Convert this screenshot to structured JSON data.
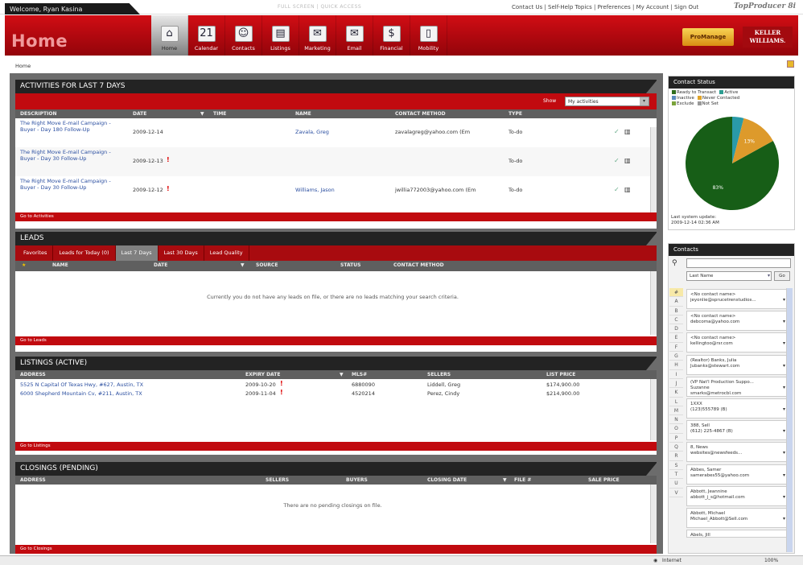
{
  "topbar": {
    "welcome": "Welcome, Ryan Kasina",
    "quick_links": "FULL SCREEN  |  QUICK ACCESS",
    "links": "Contact Us | Self-Help Topics | Preferences | My Account | Sign Out",
    "brand": "TopProducer 8i"
  },
  "header": {
    "title": "Home",
    "promanage": "ProManage",
    "kw_logo": "KELLER WILLIAMS.",
    "nav": [
      {
        "label": "Home",
        "icon": "home-icon",
        "glyph": "⌂"
      },
      {
        "label": "Calendar",
        "icon": "calendar-icon",
        "glyph": "21"
      },
      {
        "label": "Contacts",
        "icon": "contacts-icon",
        "glyph": "☺"
      },
      {
        "label": "Listings",
        "icon": "listings-icon",
        "glyph": "▤"
      },
      {
        "label": "Marketing",
        "icon": "marketing-icon",
        "glyph": "✉"
      },
      {
        "label": "Email",
        "icon": "email-icon",
        "glyph": "✉"
      },
      {
        "label": "Financial",
        "icon": "financial-icon",
        "glyph": "$"
      },
      {
        "label": "Mobility",
        "icon": "mobility-icon",
        "glyph": "▯"
      }
    ]
  },
  "breadcrumb": "Home",
  "activities": {
    "title": "ACTIVITIES FOR LAST 7 DAYS",
    "show_label": "Show",
    "show_value": "My activities",
    "headers": [
      "DESCRIPTION",
      "DATE",
      "TIME",
      "NAME",
      "CONTACT METHOD",
      "TYPE"
    ],
    "rows": [
      {
        "desc": "The Right Move E-mail Campaign - Buyer - Day 180 Follow-Up",
        "date": "2009-12-14",
        "name": "Zavala, Greg",
        "method": "zavalagreg@yahoo.com (Em",
        "type": "To-do"
      },
      {
        "desc": "The Right Move E-mail Campaign - Buyer - Day 30 Follow-Up",
        "date": "2009-12-13",
        "name": "",
        "method": "",
        "type": "To-do"
      },
      {
        "desc": "The Right Move E-mail Campaign - Buyer - Day 30 Follow-Up",
        "date": "2009-12-12",
        "name": "Williams, Jason",
        "method": "jwillia772003@yahoo.com (Em",
        "type": "To-do"
      }
    ],
    "footer": "Go to Activities"
  },
  "leads": {
    "title": "LEADS",
    "tabs": [
      "Favorites",
      "Leads for Today (0)",
      "Last 7 Days",
      "Last 30 Days",
      "Lead Quality"
    ],
    "headers": [
      "NAME",
      "DATE",
      "SOURCE",
      "STATUS",
      "CONTACT METHOD"
    ],
    "empty": "Currently you do not have any leads on file, or there are no leads matching your search criteria.",
    "footer": "Go to Leads"
  },
  "listings": {
    "title": "LISTINGS (ACTIVE)",
    "headers": [
      "ADDRESS",
      "EXPIRY DATE",
      "MLS#",
      "SELLERS",
      "LIST PRICE"
    ],
    "rows": [
      {
        "address": "5525 N Capital Of Texas Hwy, #627, Austin, TX",
        "expiry": "2009-10-20",
        "mls": "6880090",
        "sellers": "Liddell, Greg",
        "price": "$174,900.00"
      },
      {
        "address": "6000 Shepherd Mountain Cv, #211, Austin, TX",
        "expiry": "2009-11-04",
        "mls": "4520214",
        "sellers": "Perez, Cindy",
        "price": "$214,900.00"
      }
    ],
    "footer": "Go to Listings"
  },
  "closings": {
    "title": "CLOSINGS (PENDING)",
    "headers": [
      "ADDRESS",
      "SELLERS",
      "BUYERS",
      "CLOSING DATE",
      "FILE #",
      "SALE PRICE"
    ],
    "empty": "There are no pending closings on file.",
    "footer": "Go to Closings"
  },
  "contact_status": {
    "title": "Contact Status",
    "legend": [
      {
        "label": "Ready to Transact",
        "color": "#2f6d1d"
      },
      {
        "label": "Active",
        "color": "#2c9d91"
      },
      {
        "label": "Inactive",
        "color": "#5b8bbd"
      },
      {
        "label": "Never Contacted",
        "color": "#e0a428"
      },
      {
        "label": "Exclude",
        "color": "#7aa33a"
      },
      {
        "label": "Not Set",
        "color": "#999999"
      }
    ],
    "chart_data": {
      "type": "pie",
      "values": [
        83,
        4,
        13
      ],
      "labels": [
        "83%",
        "",
        "13%"
      ],
      "colors": [
        "#175e17",
        "#2a9aa8",
        "#dd9a2b"
      ]
    },
    "update_label": "Last system update:",
    "update_value": "2009-12-14 02:36 AM"
  },
  "contacts": {
    "title": "Contacts",
    "search_placeholder": "",
    "sort_value": "Last Name",
    "go": "Go",
    "letters": [
      "#",
      "A",
      "B",
      "C",
      "D",
      "E",
      "F",
      "G",
      "H",
      "I",
      "J",
      "K",
      "L",
      "M",
      "N",
      "O",
      "P",
      "Q",
      "R",
      "S",
      "T",
      "U",
      "V"
    ],
    "cards": [
      {
        "l1": "<No contact name>",
        "l2": "jeyonlie@sprucetrenstudios..."
      },
      {
        "l1": "<No contact name>",
        "l2": "debcoma@yahoo.com"
      },
      {
        "l1": "<No contact name>",
        "l2": "kellingtoo@rsr.com"
      },
      {
        "l1": "(Realtor) Banks, Julia",
        "l2": "Jubanks@stewart.com"
      },
      {
        "l1": "(VP Nat'l Production Suppo...",
        "l2": "Suzanne",
        "l3": "smarks@metrocbl.com"
      },
      {
        "l1": "1XXX",
        "l2": "(123)555789 (B)"
      },
      {
        "l1": "388, Sell",
        "l2": "(612) 225-4867 (B)"
      },
      {
        "l1": "8, News",
        "l2": "websites@newsfeeds..."
      },
      {
        "l1": "Abbes, Samer",
        "l2": "samerabes55@yahoo.com"
      },
      {
        "l1": "Abbott, Jeannine",
        "l2": "abbott_j_s@hotmail.com"
      },
      {
        "l1": "Abbott, Michael",
        "l2": "Michael_Abbott@Sell.com"
      },
      {
        "l1": "Abels, Jill",
        "l2": ""
      }
    ]
  },
  "statusbar": {
    "zone": "Internet",
    "zoom": "100%"
  }
}
